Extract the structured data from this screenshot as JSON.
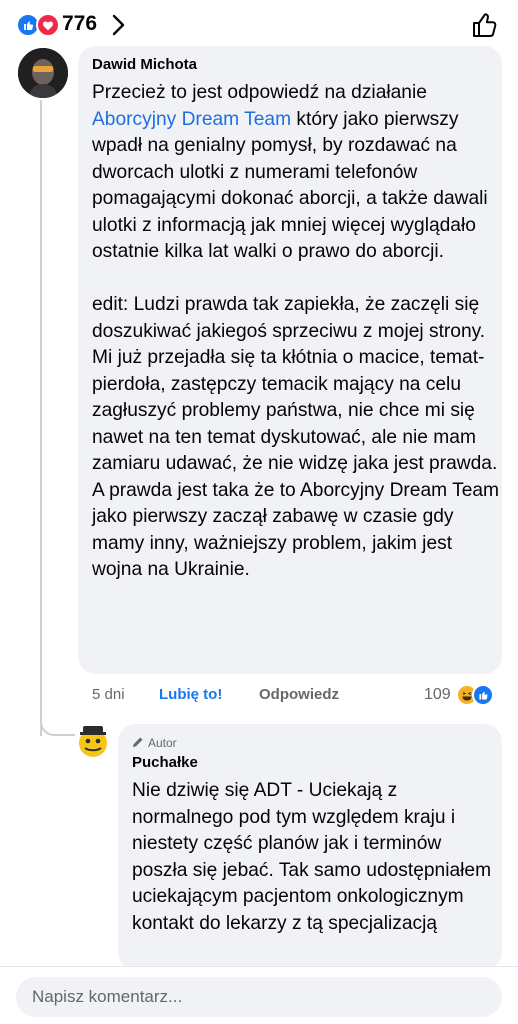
{
  "reactions": {
    "count": "776",
    "icons": [
      "like-icon",
      "love-icon"
    ]
  },
  "comment": {
    "author": "Dawid Michota",
    "text_before_link": "Przecież to jest odpowiedź na działanie ",
    "link_text": "Aborcyjny Dream Team",
    "text_after_link": " który jako pierwszy wpadł na genialny pomysł, by rozdawać na dworcach ulotki z numerami telefonów pomagającymi dokonać aborcji, a także dawali ulotki z informacją jak mniej więcej wyglądało ostatnie kilka lat walki o prawo do aborcji.\n\nedit: Ludzi prawda tak zapiekła, że zaczęli się doszukiwać jakiegoś sprzeciwu z mojej strony. Mi już przejadła się ta kłótnia o macice, temat-pierdoła, zastępczy temacik mający na celu zagłuszyć problemy państwa, nie chce mi się nawet na ten temat dyskutować, ale nie mam zamiaru udawać, że nie widzę jaka jest prawda. A prawda jest taka że to Aborcyjny Dream Team jako pierwszy zaczął zabawę w czasie gdy mamy inny, ważniejszy problem, jakim jest wojna na Ukrainie.",
    "time": "5 dni",
    "like_label": "Lubię to!",
    "reply_label": "Odpowiedz",
    "reaction_count": "109",
    "reaction_icons": [
      "haha-icon",
      "like-icon"
    ]
  },
  "reply": {
    "badge": "Autor",
    "author": "Puchałke",
    "text": "Nie dziwię się ADT - Uciekają z normalnego pod tym względem kraju i niestety część planów jak i terminów poszła się jebać. Tak samo udostępniałem uciekającym pacjentom onkologicznym kontakt do lekarzy z tą specjalizacją"
  },
  "composer": {
    "placeholder": "Napisz komentarz..."
  },
  "colors": {
    "accent": "#1877f2",
    "link": "#216fdb",
    "bubble": "#f0f2f5",
    "meta": "#65676b"
  }
}
